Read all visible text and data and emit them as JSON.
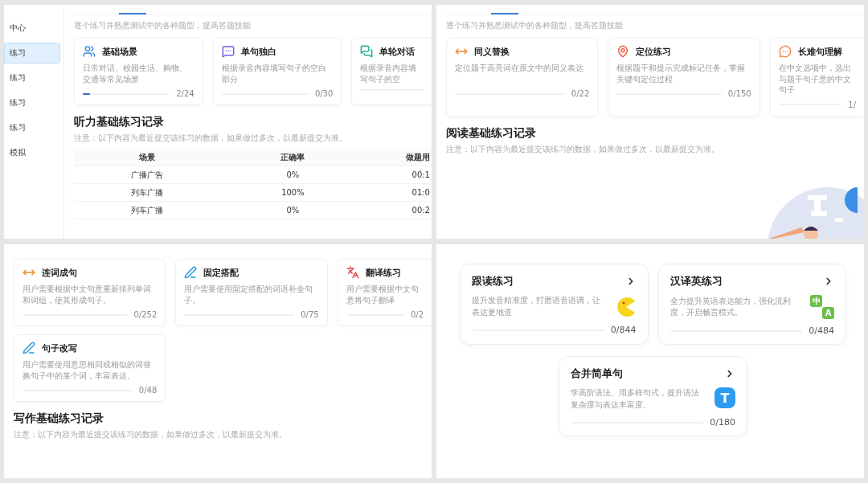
{
  "panels": [
    {
      "kind": "practice",
      "tab_bar": true,
      "sidebar": {
        "items": [
          {
            "label": "中心",
            "selected": false
          },
          {
            "label": "练习",
            "selected": true
          },
          {
            "label": "练习",
            "selected": false
          },
          {
            "label": "练习",
            "selected": false
          },
          {
            "label": "练习",
            "selected": false
          },
          {
            "label": "模拟",
            "selected": false
          }
        ]
      },
      "subtitle": "逐个练习并熟悉测试中的各种题型，提高答题技能",
      "cards": [
        {
          "kind": "scene",
          "title": "基础场景",
          "description": "日常对话、校园生活、购物、交通等常见场景",
          "count": "2/24",
          "level": 0.08
        },
        {
          "kind": "chat",
          "title": "单句独白",
          "description": "根据录音内容填写句子的空白部分",
          "count": "0/30"
        },
        {
          "kind": "dialog",
          "title": "单轮对话",
          "description": "根据录音内容填写句子的空"
        }
      ],
      "record": {
        "title": "听力基础练习记录",
        "note": "注意：以下内容为最近提交该练习的数据，如果做过多次，以最新提交为准。",
        "table": {
          "columns": [
            "场景",
            "正确率",
            "做题用"
          ],
          "rows": [
            [
              "广播广告",
              "0%",
              "00:1"
            ],
            [
              "列车广播",
              "100%",
              "01:0"
            ],
            [
              "列车广播",
              "0%",
              "00:2"
            ]
          ]
        }
      }
    },
    {
      "kind": "practice",
      "tab_bar": true,
      "subtitle": "逐个练习并熟悉测试中的各种题型，提高答题技能",
      "illustration": true,
      "cards": [
        {
          "kind": "swap",
          "title": "同义替换",
          "description": "定位题干高亮词在原文中的同义表达",
          "count": "0/22"
        },
        {
          "kind": "pin",
          "title": "定位练习",
          "description": "根据题干和提示完成标记任务，掌握关键句定位过程",
          "count": "0/150"
        },
        {
          "kind": "bubble",
          "title": "长难句理解",
          "description": "在中文选项中，选出与题干句子意的中文句子",
          "count": "1/"
        }
      ],
      "record": {
        "title": "阅读基础练习记录",
        "note": "注意：以下内容为最近提交该练习的数据，如果做过多次，以最新提交为准。"
      }
    },
    {
      "kind": "practice",
      "tab_bar": false,
      "cards": [
        {
          "kind": "swap",
          "title": "连词成句",
          "description": "用户需要根据中文句意重新排列单词和词组，使其形成句子。",
          "count": "0/252"
        },
        {
          "kind": "pen",
          "title": "固定搭配",
          "description": "用户需要使用固定搭配的词语补全句子。",
          "count": "0/75"
        },
        {
          "kind": "translate",
          "title": "翻译练习",
          "description": "用户需要根据中文句意将句子翻译",
          "count": "0/2"
        },
        {
          "kind": "pen",
          "title": "句子改写",
          "description": "用户需要使用意思相同或相似的词替换句子中的某个词，丰富表达。",
          "count": "0/48"
        }
      ],
      "record": {
        "title": "写作基础练习记录",
        "note": "注意：以下内容为最近提交该练习的数据，如果做过多次，以最新提交为准。"
      }
    },
    {
      "kind": "speaking",
      "cards": [
        {
          "kind": "pacman",
          "title": "跟读练习",
          "description": "提升发音精准度，打磨语音语调，让表达更地道",
          "count": "0/844"
        },
        {
          "kind": "tiles",
          "title": "汉译英练习",
          "description": "全力提升英语表达能力，强化流利度，开启畅言模式。",
          "count": "0/484",
          "icon_labels": [
            "中",
            "A"
          ]
        },
        {
          "kind": "tile",
          "title": "合并简单句",
          "description": "学高阶语法、用多样句式，提升语法复杂度与表达丰富度。",
          "count": "0/180",
          "icon_labels": [
            "T"
          ]
        }
      ]
    }
  ]
}
